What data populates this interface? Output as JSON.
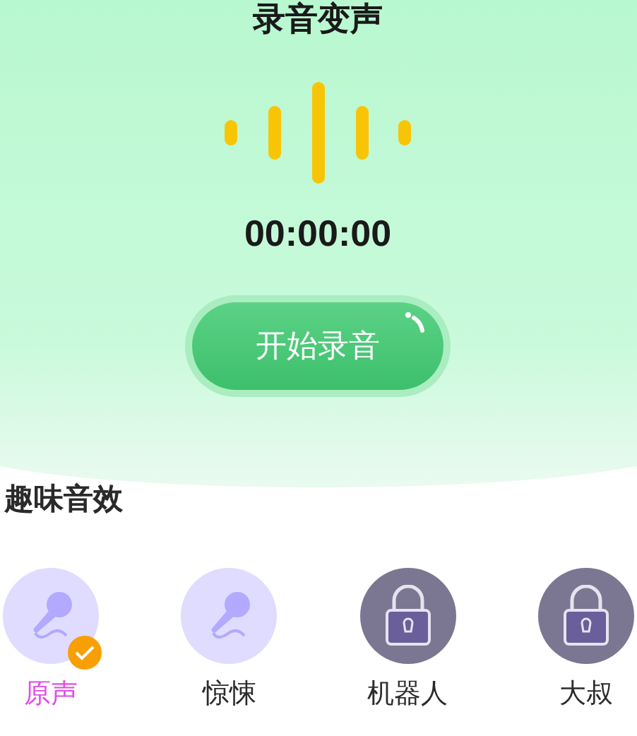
{
  "header": {
    "title": "录音变声",
    "timer": "00:00:00",
    "record_button": "开始录音"
  },
  "effects_section": {
    "title": "趣味音效",
    "effects": [
      {
        "label": "原声",
        "kind": "open",
        "selected": true
      },
      {
        "label": "惊悚",
        "kind": "open",
        "selected": false
      },
      {
        "label": "机器人",
        "kind": "locked",
        "selected": false
      },
      {
        "label": "大叔",
        "kind": "locked",
        "selected": false
      }
    ]
  }
}
